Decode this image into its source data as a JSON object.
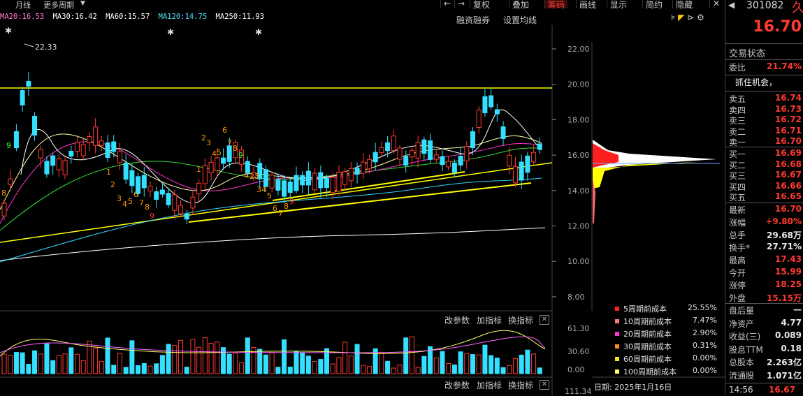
{
  "topbar": {
    "left_items": [
      "月线",
      "更多周期"
    ],
    "buttons": [
      "复权",
      "叠加",
      "筹码",
      "画线",
      "显示",
      "简约",
      "隐藏"
    ],
    "active": "筹码"
  },
  "ma_line": [
    {
      "label": "MA20:16.53",
      "color": "#ff7fd2"
    },
    {
      "label": "MA30:16.42",
      "color": "#ffffff"
    },
    {
      "label": "MA60:15.57",
      "color": "#ffffff"
    },
    {
      "label": "MA120:14.75",
      "color": "#4fe0ff"
    },
    {
      "label": "MA250:11.93",
      "color": "#ffffff"
    }
  ],
  "chart_controls": {
    "rzrq": "融资融券",
    "set_ma": "设置均线"
  },
  "price_axis": {
    "ticks": [
      "22.00",
      "20.00",
      "18.00",
      "16.00",
      "14.00",
      "12.00",
      "10.00",
      "8.00"
    ]
  },
  "max_label": "22.33",
  "volume_axis": {
    "ticks": [
      "61.30",
      "30.60",
      "0.00"
    ]
  },
  "next_axis_top": "111.34",
  "sub_panel": {
    "adjust": "改参数",
    "add": "加指标",
    "switch": "换指标"
  },
  "chip_legend": [
    {
      "label": "5周期前成本",
      "pct": "25.55%",
      "color": "#ff2020"
    },
    {
      "label": "10周期前成本",
      "pct": "7.47%",
      "color": "#ff7777"
    },
    {
      "label": "20周期前成本",
      "pct": "2.90%",
      "color": "#ff33cc"
    },
    {
      "label": "30周期前成本",
      "pct": "0.31%",
      "color": "#ff8c1a"
    },
    {
      "label": "60周期前成本",
      "pct": "0.00%",
      "color": "#ffe020"
    },
    {
      "label": "100周期前成本",
      "pct": "0.00%",
      "color": "#ffff66"
    }
  ],
  "date_label": "日期: 2025年1月16日",
  "stock": {
    "code": "301082",
    "name_short": "久",
    "price": "16.70"
  },
  "status": "交易状态",
  "weibi": {
    "label": "委比",
    "value": "21.74%"
  },
  "news": "抓住机会，",
  "asks": [
    {
      "label": "卖五",
      "price": "16.74"
    },
    {
      "label": "卖四",
      "price": "16.73"
    },
    {
      "label": "卖三",
      "price": "16.72"
    },
    {
      "label": "卖二",
      "price": "16.71"
    },
    {
      "label": "卖一",
      "price": "16.70"
    }
  ],
  "bids": [
    {
      "label": "买一",
      "price": "16.69"
    },
    {
      "label": "买二",
      "price": "16.68"
    },
    {
      "label": "买三",
      "price": "16.67"
    },
    {
      "label": "买四",
      "price": "16.66"
    },
    {
      "label": "买五",
      "price": "16.65"
    }
  ],
  "quote": [
    {
      "label": "最新",
      "value": "16.70",
      "color": "red"
    },
    {
      "label": "涨幅",
      "value": "+9.80%",
      "color": "red"
    },
    {
      "label": "总手",
      "value": "29.68万",
      "color": "white"
    },
    {
      "label": "换手*",
      "value": "27.71%",
      "color": "white"
    },
    {
      "label": "最高",
      "value": "17.43",
      "color": "red"
    },
    {
      "label": "今开",
      "value": "15.99",
      "color": "red"
    },
    {
      "label": "涨停",
      "value": "18.25",
      "color": "red"
    },
    {
      "label": "外盘",
      "value": "15.15万",
      "color": "red"
    }
  ],
  "fund": [
    {
      "label": "盘后量",
      "value": "—"
    },
    {
      "label": "净资产",
      "value": "4.77"
    },
    {
      "label": "收益(三)",
      "value": "0.089"
    },
    {
      "label": "股息TTM",
      "value": "0.18"
    },
    {
      "label": "总股本",
      "value": "2.263亿"
    },
    {
      "label": "流通股",
      "value": "1.071亿"
    }
  ],
  "bottom_time": "14:56",
  "bottom_price": "16.67"
}
